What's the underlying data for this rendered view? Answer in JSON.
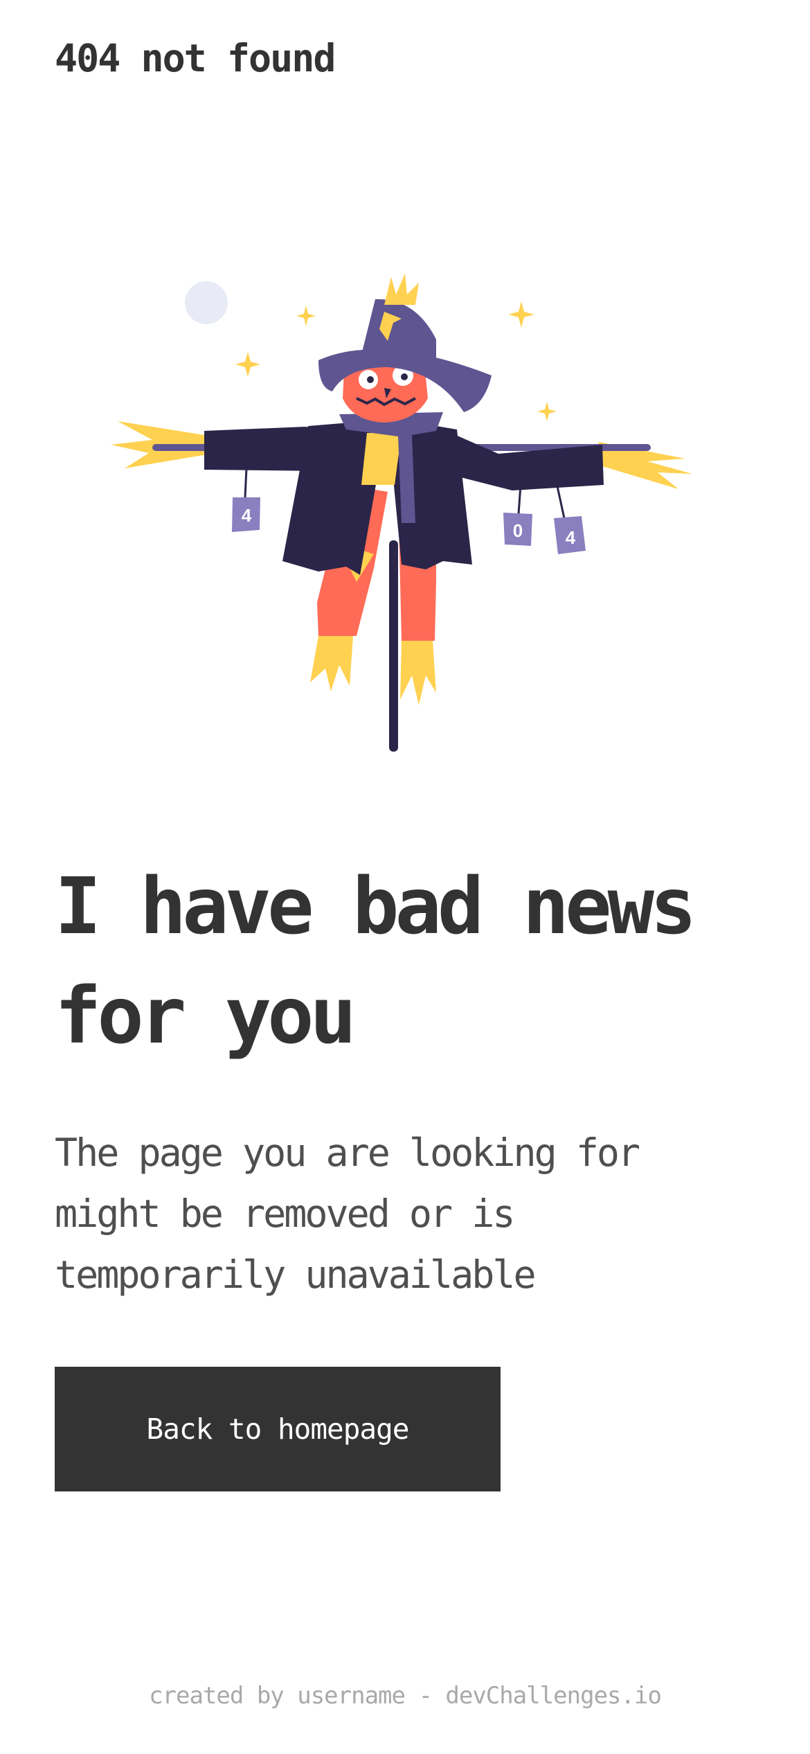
{
  "header": {
    "logo_text": "404 not found"
  },
  "illustration": {
    "icon": "scarecrow-illustration",
    "can_labels": [
      "4",
      "0",
      "4"
    ]
  },
  "main": {
    "headline_line1": "I have bad news",
    "headline_line2": "for you",
    "body_line1": "The page you are looking for",
    "body_line2": "might be removed or is",
    "body_line3": "temporarily unavailable",
    "button_label": "Back to homepage"
  },
  "footer": {
    "credit_text": "created by username - devChallenges.io"
  },
  "colors": {
    "text_dark": "#333333",
    "text_body": "#4f4f4f",
    "footer_text": "#a9a9a9",
    "button_bg": "#333333",
    "button_text": "#ffffff",
    "scarecrow_coat": "#2b2549",
    "scarecrow_hat": "#5e5591",
    "scarecrow_face": "#ff6b57",
    "straw": "#ffd150",
    "moon": "#e8ebf5"
  }
}
